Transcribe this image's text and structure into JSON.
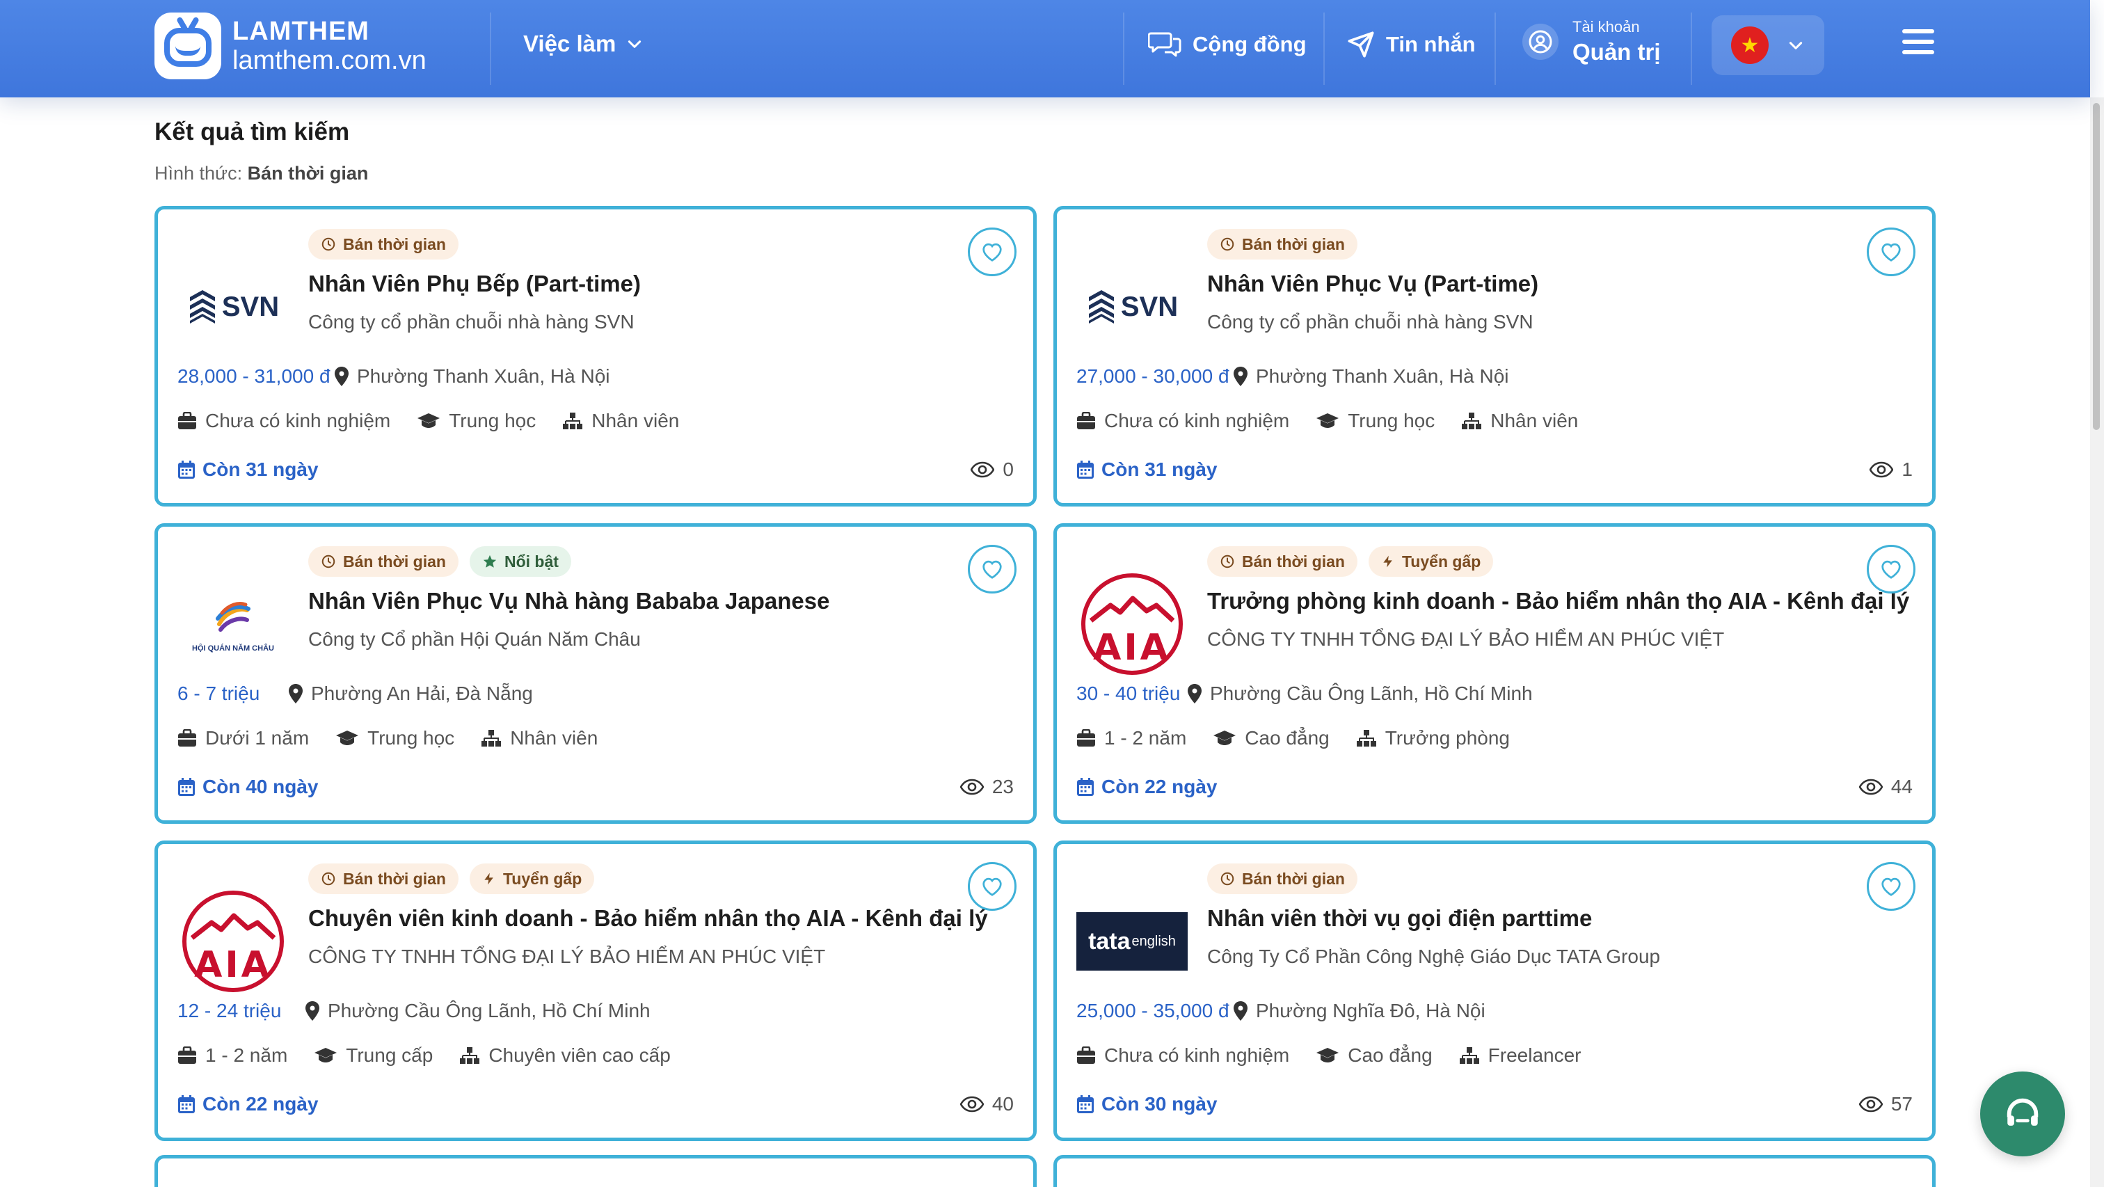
{
  "brand": {
    "title": "LAMTHEM",
    "url": "lamthem.com.vn"
  },
  "nav": {
    "jobs": "Việc làm",
    "community": "Cộng đồng",
    "messages": "Tin nhắn",
    "account_small": "Tài khoản",
    "account_big": "Quản trị"
  },
  "page": {
    "heading": "Kết quả tìm kiếm",
    "filter_label": "Hình thức:",
    "filter_value": "Bán thời gian"
  },
  "cards": [
    {
      "badges": [
        "Bán thời gian"
      ],
      "title": "Nhân Viên Phụ Bếp (Part-time)",
      "company": "Công ty cổ phần chuỗi nhà hàng SVN",
      "salary": "28,000 - 31,000 đ",
      "location": "Phường Thanh Xuân, Hà Nội",
      "experience": "Chưa có kinh nghiệm",
      "education": "Trung học",
      "level": "Nhân viên",
      "deadline": "Còn 31 ngày",
      "views": "0",
      "logo": "SVN"
    },
    {
      "badges": [
        "Bán thời gian"
      ],
      "title": "Nhân Viên Phục Vụ (Part-time)",
      "company": "Công ty cổ phần chuỗi nhà hàng SVN",
      "salary": "27,000 - 30,000 đ",
      "location": "Phường Thanh Xuân, Hà Nội",
      "experience": "Chưa có kinh nghiệm",
      "education": "Trung học",
      "level": "Nhân viên",
      "deadline": "Còn 31 ngày",
      "views": "1",
      "logo": "SVN"
    },
    {
      "badges": [
        "Bán thời gian",
        "Nổi bật"
      ],
      "title": "Nhân Viên Phục Vụ Nhà hàng Bababa Japanese",
      "company": "Công ty Cổ phần Hội Quán Năm Châu",
      "salary": "6 - 7 triệu",
      "location": "Phường An Hải, Đà Nẵng",
      "experience": "Dưới 1 năm",
      "education": "Trung học",
      "level": "Nhân viên",
      "deadline": "Còn 40 ngày",
      "views": "23",
      "logo": "HỘI QUÁN NĂM CHÂU"
    },
    {
      "badges": [
        "Bán thời gian",
        "Tuyển gấp"
      ],
      "title": "Trưởng phòng kinh doanh - Bảo hiểm nhân thọ AIA - Kênh đại lý",
      "company": "CÔNG TY TNHH TỔNG ĐẠI LÝ BẢO HIỂM AN PHÚC VIỆT",
      "salary": "30 - 40 triệu",
      "location": "Phường Cầu Ông Lãnh, Hồ Chí Minh",
      "experience": "1 - 2 năm",
      "education": "Cao đẳng",
      "level": "Trưởng phòng",
      "deadline": "Còn 22 ngày",
      "views": "44",
      "logo": "AIA"
    },
    {
      "badges": [
        "Bán thời gian",
        "Tuyển gấp"
      ],
      "title": "Chuyên viên kinh doanh - Bảo hiểm nhân thọ AIA - Kênh đại lý",
      "company": "CÔNG TY TNHH TỔNG ĐẠI LÝ BẢO HIỂM AN PHÚC VIỆT",
      "salary": "12 - 24 triệu",
      "location": "Phường Cầu Ông Lãnh, Hồ Chí Minh",
      "experience": "1 - 2 năm",
      "education": "Trung cấp",
      "level": "Chuyên viên cao cấp",
      "deadline": "Còn 22 ngày",
      "views": "40",
      "logo": "AIA"
    },
    {
      "badges": [
        "Bán thời gian"
      ],
      "title": "Nhân viên thời vụ gọi điện parttime",
      "company": "Công Ty Cổ Phần Công Nghệ Giáo Dục TATA Group",
      "salary": "25,000 - 35,000 đ",
      "location": "Phường Nghĩa Đô, Hà Nội",
      "experience": "Chưa có kinh nghiệm",
      "education": "Cao đẳng",
      "level": "Freelancer",
      "deadline": "Còn 30 ngày",
      "views": "57",
      "logo": "tata english"
    }
  ],
  "colors": {
    "header_blue": "#4e86e6",
    "card_border": "#3fb1d8",
    "link_blue": "#2a62c7",
    "badge_bg": "#fcefe3",
    "support_green": "#2d8a6c"
  }
}
